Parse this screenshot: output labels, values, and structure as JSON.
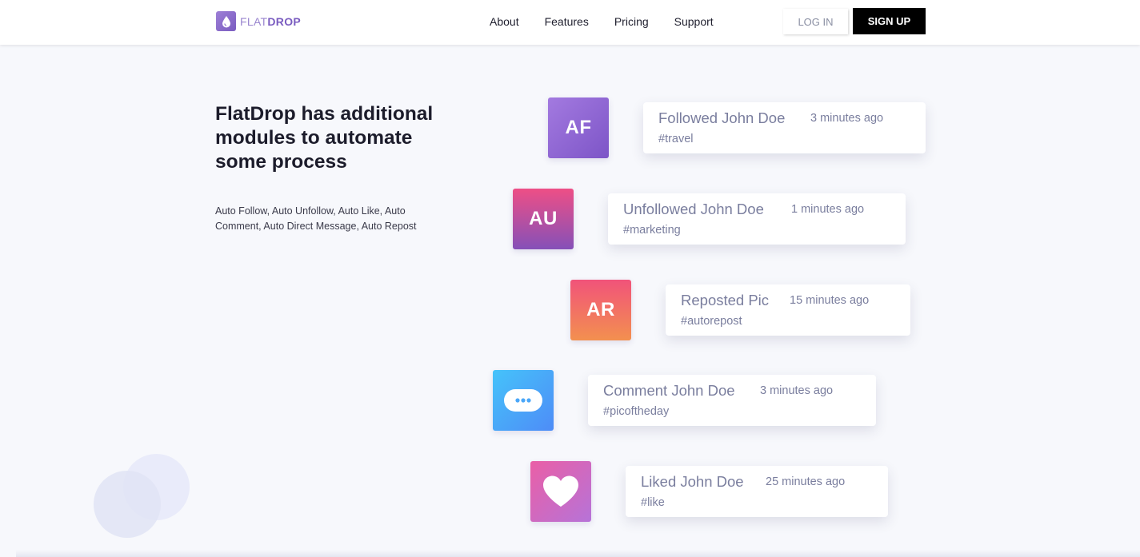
{
  "brand": {
    "light": "FLAT",
    "bold": "DROP",
    "accent": "#7a5cc0"
  },
  "nav": {
    "links": [
      "About",
      "Features",
      "Pricing",
      "Support"
    ],
    "login_label": "LOG IN",
    "signup_label": "SIGN UP"
  },
  "hero": {
    "title": "FlatDrop has additional modules to automate some process",
    "subtitle": "Auto Follow, Auto Unfollow, Auto Like, Auto Comment, Auto Direct Message, Auto Repost"
  },
  "activity": [
    {
      "badge": "AF",
      "title": "Followed John Doe",
      "time": "3 minutes ago",
      "tag": "#travel",
      "gradient": [
        "#a37ae0",
        "#7d55c7"
      ]
    },
    {
      "badge": "AU",
      "title": "Unfollowed John Doe",
      "time": "1 minutes ago",
      "tag": "#marketing",
      "gradient": [
        "#ee4f86",
        "#8550b8"
      ]
    },
    {
      "badge": "AR",
      "title": "Reposted Pic",
      "time": "15 minutes ago",
      "tag": "#autorepost",
      "gradient": [
        "#f1537a",
        "#f3904f"
      ]
    },
    {
      "badge": "",
      "icon": "chat-bubble-icon",
      "title": "Comment John Doe",
      "time": "3 minutes ago",
      "tag": "#picoftheday",
      "gradient": [
        "#45c3fa",
        "#4e8cf7"
      ]
    },
    {
      "badge": "",
      "icon": "heart-icon",
      "title": "Liked John Doe",
      "time": "25 minutes ago",
      "tag": "#like",
      "gradient": [
        "#ea5fa6",
        "#b673d8"
      ]
    }
  ]
}
